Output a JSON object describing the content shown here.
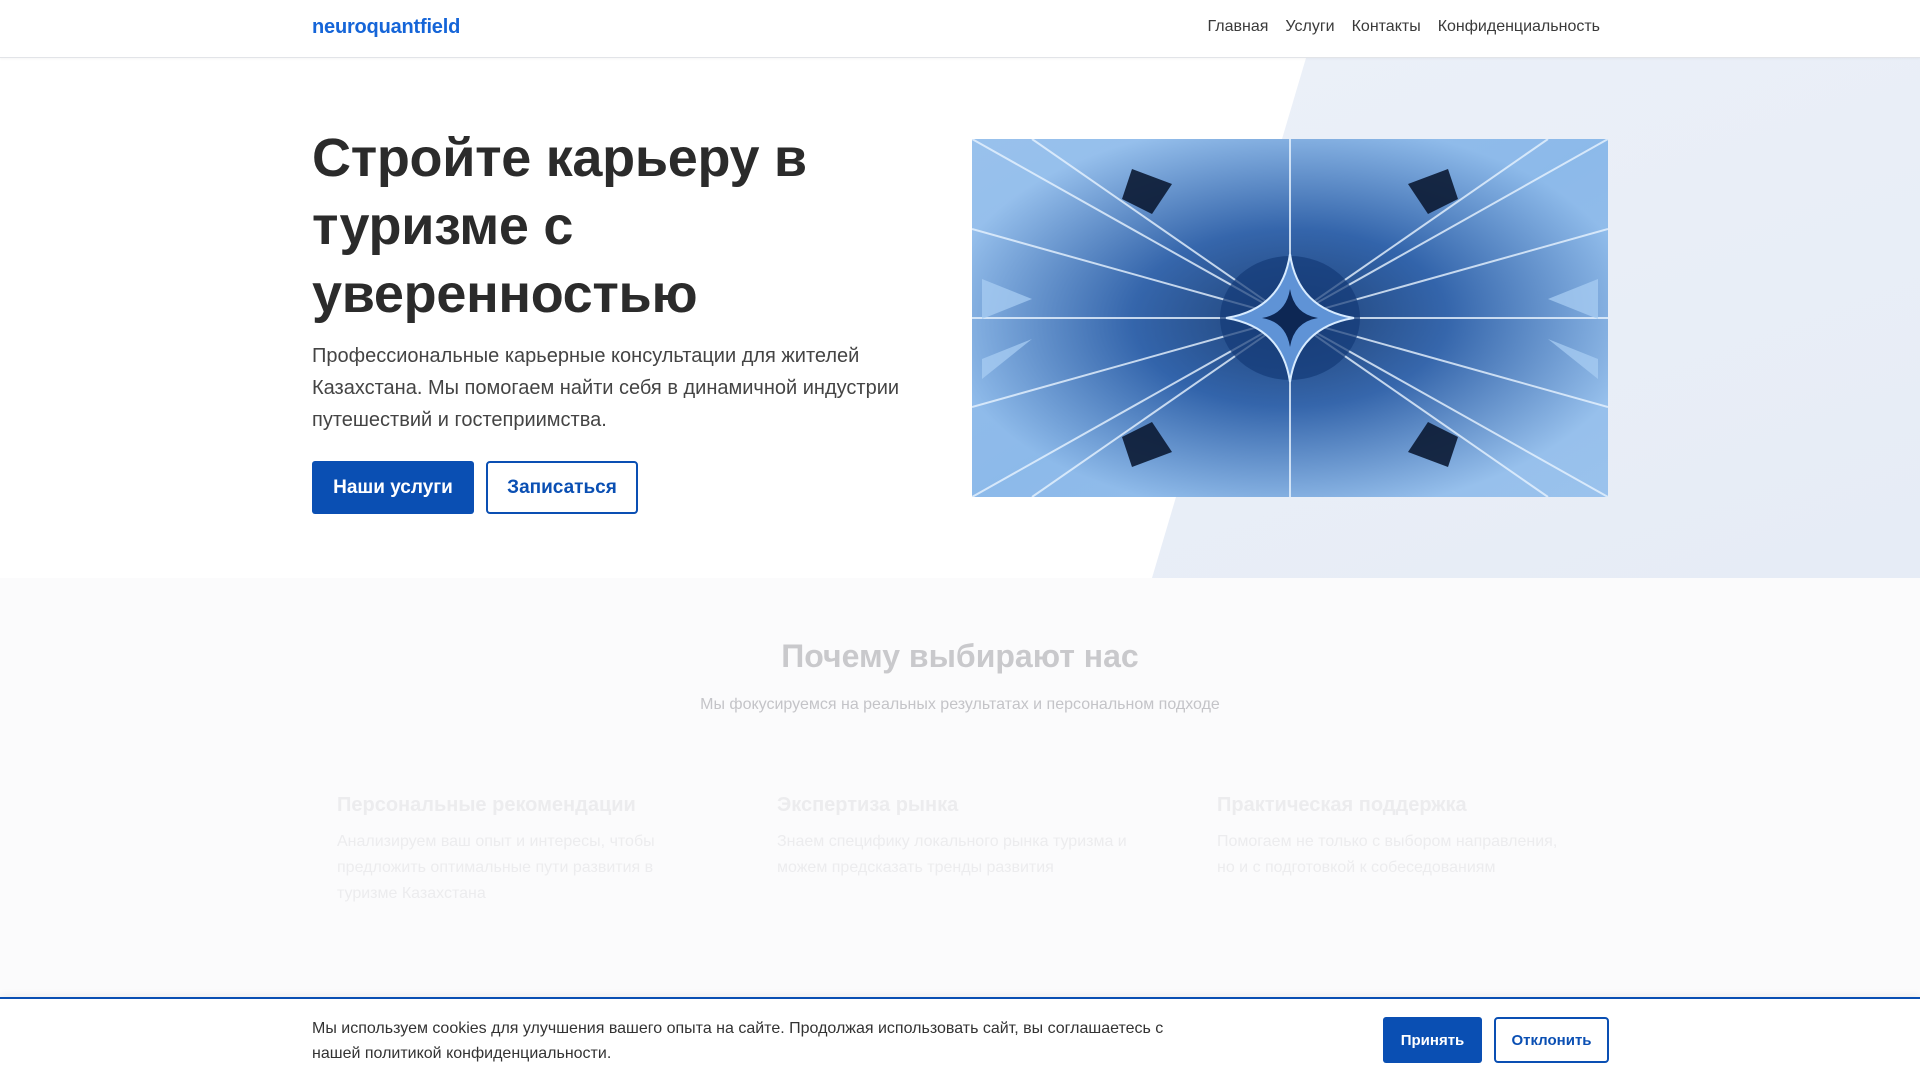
{
  "header": {
    "logo": "neuroquantfield",
    "nav": [
      {
        "label": "Главная"
      },
      {
        "label": "Услуги"
      },
      {
        "label": "Контакты"
      },
      {
        "label": "Конфиденциальность"
      }
    ]
  },
  "hero": {
    "title": "Стройте карьеру в туризме с уверенностью",
    "subtitle": "Профессиональные карьерные консультации для жителей Казахстана. Мы помогаем найти себя в динамичной индустрии путешествий и гостеприимства.",
    "primary_button": "Наши услуги",
    "secondary_button": "Записаться"
  },
  "why": {
    "title": "Почему выбирают нас",
    "subtitle": "Мы фокусируемся на реальных результатах и персональном подходе",
    "features": [
      {
        "title": "Персональные рекомендации",
        "text": "Анализируем ваш опыт и интересы, чтобы предложить оптимальные пути развития в туризме Казахстана"
      },
      {
        "title": "Экспертиза рынка",
        "text": "Знаем специфику локального рынка туризма и можем предсказать тренды развития"
      },
      {
        "title": "Практическая поддержка",
        "text": "Помогаем не только с выбором направления, но и с подготовкой к собеседованиям"
      }
    ]
  },
  "cookie": {
    "text": "Мы используем cookies для улучшения вашего опыта на сайте. Продолжая использовать сайт, вы соглашаетесь с нашей политикой конфиденциальности.",
    "accept": "Принять",
    "decline": "Отклонить"
  },
  "colors": {
    "brand": "#1565d8",
    "primary_button": "#0a4fb3",
    "hero_accent_bg": "#e6ecf6"
  }
}
